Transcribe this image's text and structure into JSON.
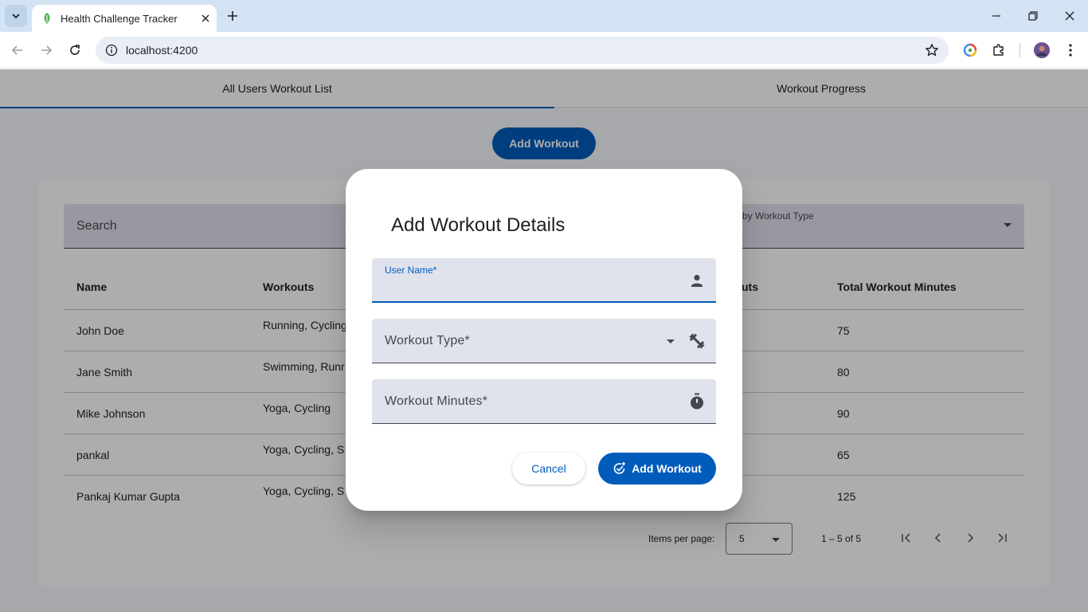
{
  "browser": {
    "tab_title": "Health Challenge Tracker",
    "url": "localhost:4200"
  },
  "app": {
    "tabs": [
      {
        "label": "All Users Workout List",
        "active": true
      },
      {
        "label": "Workout Progress",
        "active": false
      }
    ],
    "add_workout_button": "Add Workout",
    "search": {
      "placeholder": "Search"
    },
    "filter": {
      "label": "by Workout Type"
    },
    "table": {
      "headers": [
        "Name",
        "Workouts",
        "uts",
        "Total Workout Minutes"
      ],
      "rows": [
        {
          "name": "John Doe",
          "workouts": "Running, Cycling",
          "total": "75"
        },
        {
          "name": "Jane Smith",
          "workouts": "Swimming, Runr",
          "total": "80"
        },
        {
          "name": "Mike Johnson",
          "workouts": "Yoga, Cycling",
          "total": "90"
        },
        {
          "name": "pankal",
          "workouts": "Yoga, Cycling, S",
          "total": "65"
        },
        {
          "name": "Pankaj Kumar Gupta",
          "workouts": "Yoga, Cycling, S",
          "total": "125"
        }
      ]
    },
    "paginator": {
      "items_per_page_label": "Items per page:",
      "items_per_page_value": "5",
      "range": "1 – 5 of 5"
    }
  },
  "dialog": {
    "title": "Add Workout Details",
    "fields": {
      "user_name": {
        "label": "User Name*",
        "icon": "person-icon"
      },
      "workout_type": {
        "label": "Workout Type*",
        "icon": "fitness-icon"
      },
      "workout_minutes": {
        "label": "Workout Minutes*",
        "icon": "timer-icon"
      }
    },
    "cancel_label": "Cancel",
    "submit_label": "Add Workout"
  },
  "colors": {
    "primary": "#005cbb",
    "field_bg": "#e0e2ec",
    "chrome_bg": "#d3e3f4"
  }
}
